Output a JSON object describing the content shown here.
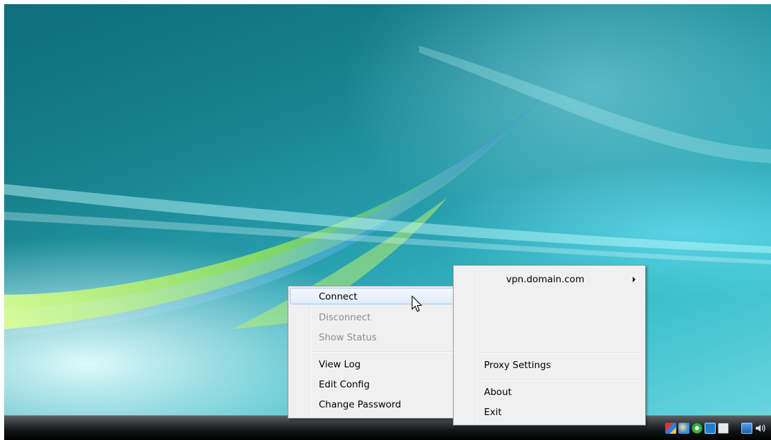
{
  "screen": {
    "background_color": "#2aa3b3",
    "taskbar_color": "#121416"
  },
  "context_menu": {
    "items": [
      {
        "label": "Connect",
        "state": "highlighted"
      },
      {
        "label": "Disconnect",
        "state": "disabled"
      },
      {
        "label": "Show Status",
        "state": "disabled"
      },
      {
        "label": "View Log",
        "state": "enabled"
      },
      {
        "label": "Edit Config",
        "state": "enabled"
      },
      {
        "label": "Change Password",
        "state": "enabled"
      }
    ]
  },
  "main_menu": {
    "connection_label": "vpn.domain.com",
    "items": [
      {
        "label": "Proxy Settings"
      },
      {
        "label": "About"
      },
      {
        "label": "Exit"
      }
    ]
  },
  "tray": {
    "icons": [
      "network-alert-icon",
      "update-icon",
      "sync-icon",
      "openvpn-icon",
      "language-icon",
      "network-icon",
      "volume-icon"
    ]
  },
  "cursor": {
    "type": "arrow-pointer"
  }
}
